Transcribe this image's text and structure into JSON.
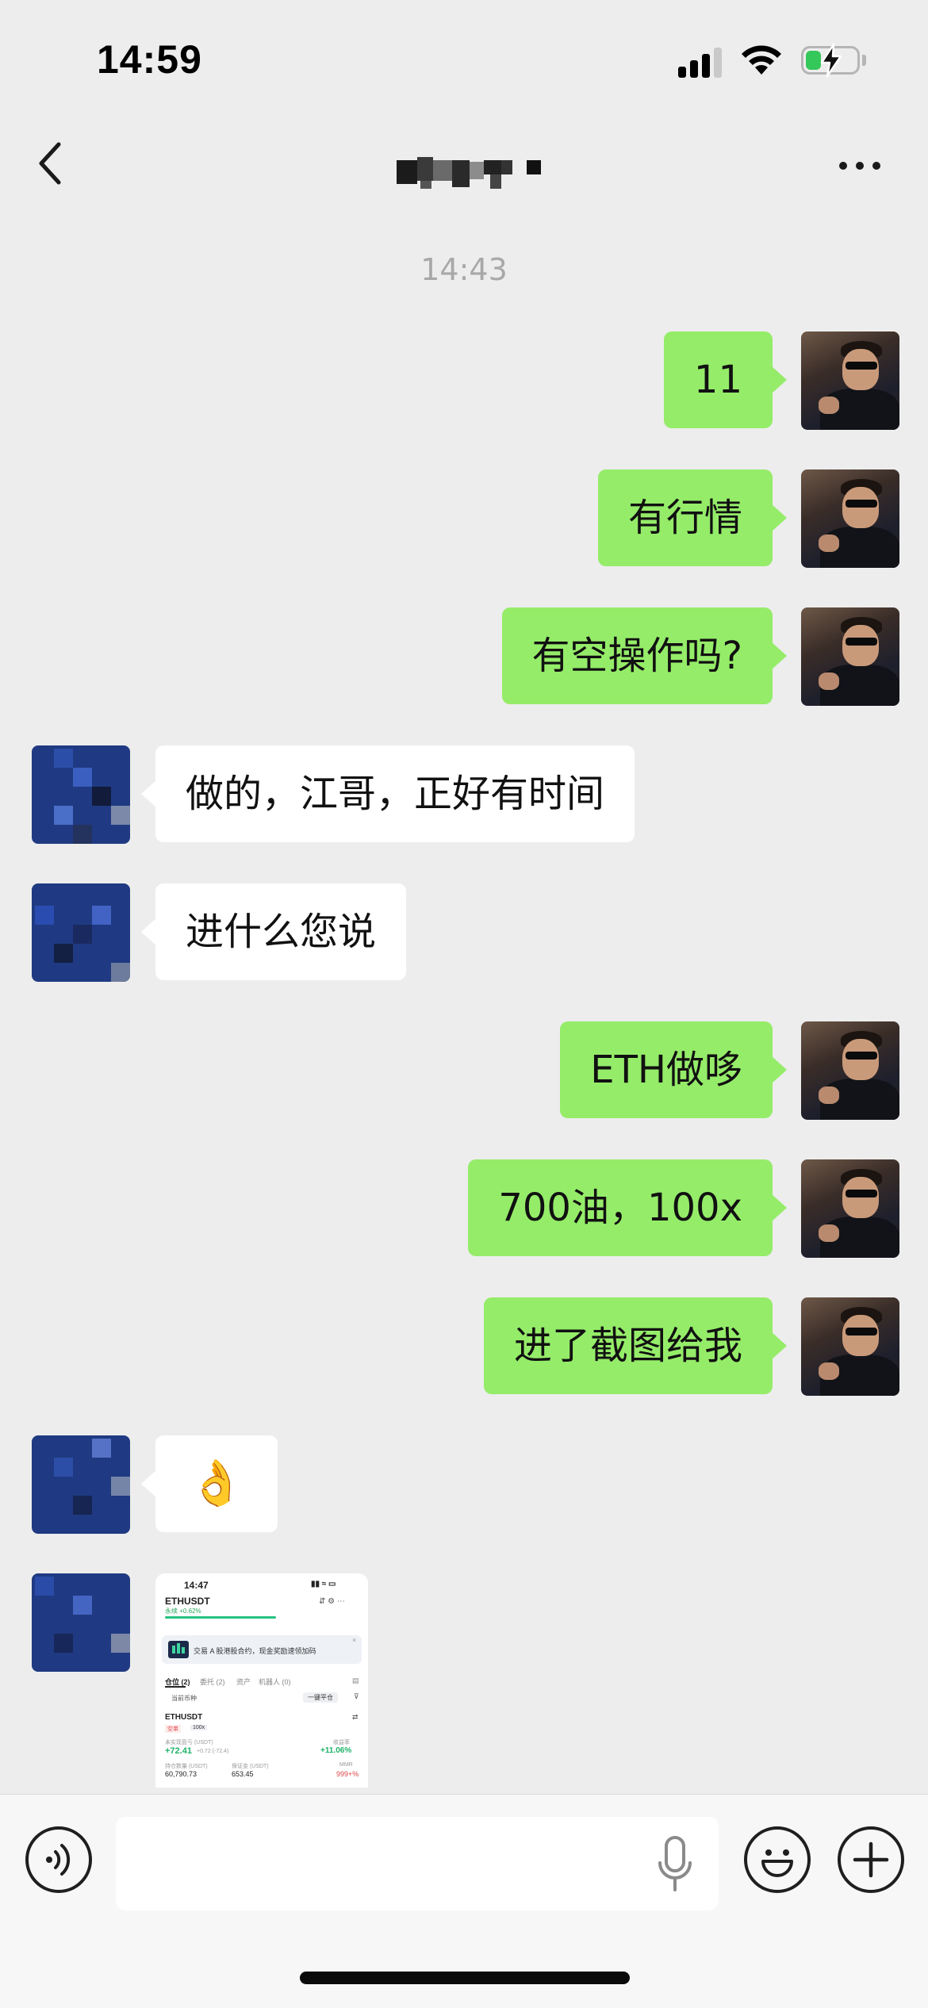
{
  "status_bar": {
    "time": "14:59",
    "battery_level": 0.3,
    "battery_charging": true
  },
  "nav": {
    "back_icon": "chevron-left-icon",
    "more_icon": "ellipsis-icon",
    "title_pixelated": true
  },
  "timestamp": "14:43",
  "messages": [
    {
      "sender": "me",
      "text": "11"
    },
    {
      "sender": "me",
      "text": "有行情"
    },
    {
      "sender": "me",
      "text": "有空操作吗?"
    },
    {
      "sender": "other",
      "text": "做的，江哥，正好有时间"
    },
    {
      "sender": "other",
      "text": "进什么您说"
    },
    {
      "sender": "me",
      "text": "ETH做哆"
    },
    {
      "sender": "me",
      "text": "700油，100x"
    },
    {
      "sender": "me",
      "text": "进了截图给我"
    },
    {
      "sender": "other",
      "text": "👌"
    },
    {
      "sender": "other",
      "type": "image"
    }
  ],
  "image_message": {
    "time": "14:47",
    "symbol": "ETHUSDT",
    "symbol_sub": "永续 +0.62%",
    "banner": "交易 A 股港股合约，现金奖励速领加码",
    "tabs": [
      "仓位 (2)",
      "委托 (2)",
      "资产",
      "机器人 (0)"
    ],
    "filter_left": "当前币种",
    "filter_right": "一键平仓",
    "position_symbol": "ETHUSDT",
    "position_tag": "空单",
    "position_leverage": "100x",
    "pnl_label": "未实现盈亏 (USDT)",
    "pnl_value": "+72.41",
    "pnl_sub": "+0.72 (-72.4)",
    "roe_label": "收益率",
    "roe_value": "+11.06%",
    "size_label": "持仓数量 (USDT)",
    "size_value": "60,790.73",
    "margin_label": "保证金 (USDT)",
    "margin_value": "653.45",
    "ratio_label": "MMR",
    "ratio_value": "999+%"
  },
  "input": {
    "value": "",
    "placeholder": ""
  },
  "icons": {
    "voice": "voice-icon",
    "mic": "microphone-icon",
    "emoji": "emoji-icon",
    "plus": "plus-icon"
  },
  "colors": {
    "background": "#ededed",
    "bubble_me": "#95ec69",
    "bubble_other": "#ffffff",
    "timestamp": "#a8a8a8"
  }
}
